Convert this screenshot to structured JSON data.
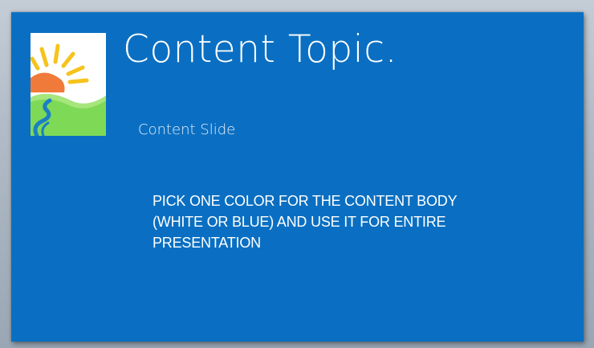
{
  "slide": {
    "title": "Content Topic.",
    "subtitle": "Content Slide",
    "body_lines": [
      "PICK ONE COLOR FOR THE CONTENT BODY",
      "(WHITE OR BLUE) AND USE IT FOR ENTIRE",
      "PRESENTATION"
    ],
    "background_color": "#0a6fc2"
  },
  "logo": {
    "icon": "sunrise-landscape-icon",
    "colors": {
      "sun": "#f07a3a",
      "rays": "#f5c31c",
      "hill": "#7ed957",
      "river": "#1a7fc4"
    }
  }
}
